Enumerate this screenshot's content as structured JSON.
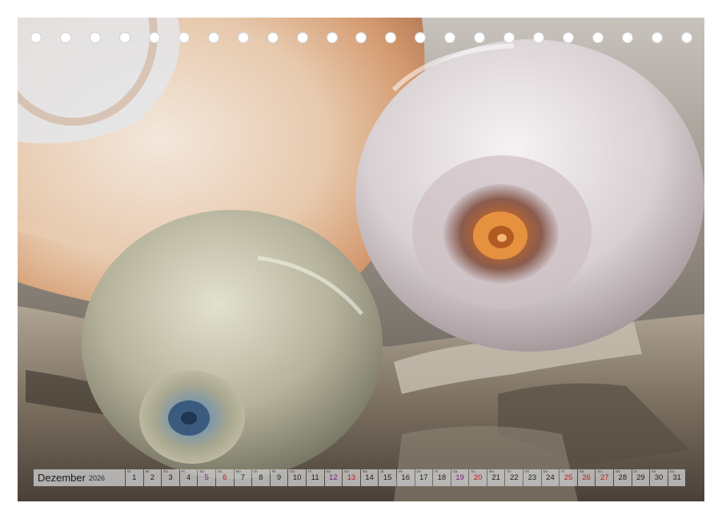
{
  "calendar": {
    "month": "Dezember",
    "year": "2026",
    "days": [
      {
        "n": "1",
        "wd": "Di",
        "t": ""
      },
      {
        "n": "2",
        "wd": "Mi",
        "t": ""
      },
      {
        "n": "3",
        "wd": "Do",
        "t": ""
      },
      {
        "n": "4",
        "wd": "Fr",
        "t": ""
      },
      {
        "n": "5",
        "wd": "Sa",
        "t": "sat"
      },
      {
        "n": "6",
        "wd": "So",
        "t": "sun"
      },
      {
        "n": "7",
        "wd": "Mo",
        "t": ""
      },
      {
        "n": "8",
        "wd": "Di",
        "t": ""
      },
      {
        "n": "9",
        "wd": "Mi",
        "t": ""
      },
      {
        "n": "10",
        "wd": "Do",
        "t": ""
      },
      {
        "n": "11",
        "wd": "Fr",
        "t": ""
      },
      {
        "n": "12",
        "wd": "Sa",
        "t": "sat"
      },
      {
        "n": "13",
        "wd": "So",
        "t": "sun"
      },
      {
        "n": "14",
        "wd": "Mo",
        "t": ""
      },
      {
        "n": "15",
        "wd": "Di",
        "t": ""
      },
      {
        "n": "16",
        "wd": "Mi",
        "t": ""
      },
      {
        "n": "17",
        "wd": "Do",
        "t": ""
      },
      {
        "n": "18",
        "wd": "Fr",
        "t": ""
      },
      {
        "n": "19",
        "wd": "Sa",
        "t": "sat"
      },
      {
        "n": "20",
        "wd": "So",
        "t": "sun"
      },
      {
        "n": "21",
        "wd": "Mo",
        "t": ""
      },
      {
        "n": "22",
        "wd": "Di",
        "t": ""
      },
      {
        "n": "23",
        "wd": "Mi",
        "t": ""
      },
      {
        "n": "24",
        "wd": "Do",
        "t": ""
      },
      {
        "n": "25",
        "wd": "Fr",
        "t": "hol"
      },
      {
        "n": "26",
        "wd": "Sa",
        "t": "hol"
      },
      {
        "n": "27",
        "wd": "So",
        "t": "sun"
      },
      {
        "n": "28",
        "wd": "Mo",
        "t": ""
      },
      {
        "n": "29",
        "wd": "Di",
        "t": ""
      },
      {
        "n": "30",
        "wd": "Mi",
        "t": ""
      },
      {
        "n": "31",
        "wd": "Do",
        "t": ""
      }
    ]
  },
  "colors": {
    "sunday": "#c4151b",
    "saturday": "#7a1a7a",
    "strip_background": "#c8c8c8"
  },
  "binding_holes": 23
}
